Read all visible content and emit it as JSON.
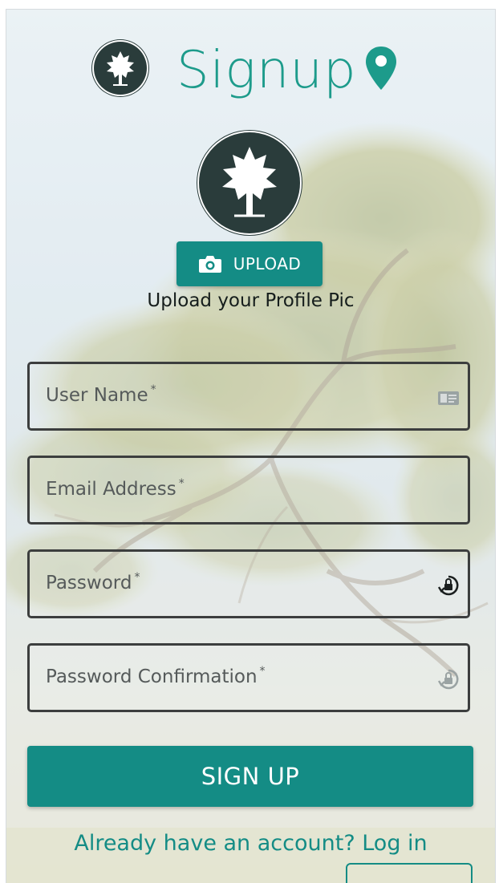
{
  "header": {
    "title": "Signup",
    "logo_icon": "tree-logo-icon",
    "location_icon": "map-pin-icon"
  },
  "profile": {
    "avatar_icon": "tree-logo-icon",
    "upload_label": "UPLOAD",
    "upload_icon": "camera-icon",
    "caption": "Upload your Profile Pic"
  },
  "form": {
    "fields": [
      {
        "label": "User Name",
        "required_mark": "*",
        "icon": "id-card-icon"
      },
      {
        "label": "Email Address",
        "required_mark": "*",
        "icon": ""
      },
      {
        "label": "Password",
        "required_mark": "*",
        "icon": "lock-rotate-icon"
      },
      {
        "label": "Password Confirmation",
        "required_mark": "*",
        "icon": "lock-rotate-icon"
      }
    ],
    "submit_label": "SIGN UP"
  },
  "footer": {
    "login_text": "Already have an account? Log in"
  },
  "colors": {
    "accent": "#148c85",
    "title": "#1d9b8b",
    "logo_bg": "#2a3c3b"
  }
}
